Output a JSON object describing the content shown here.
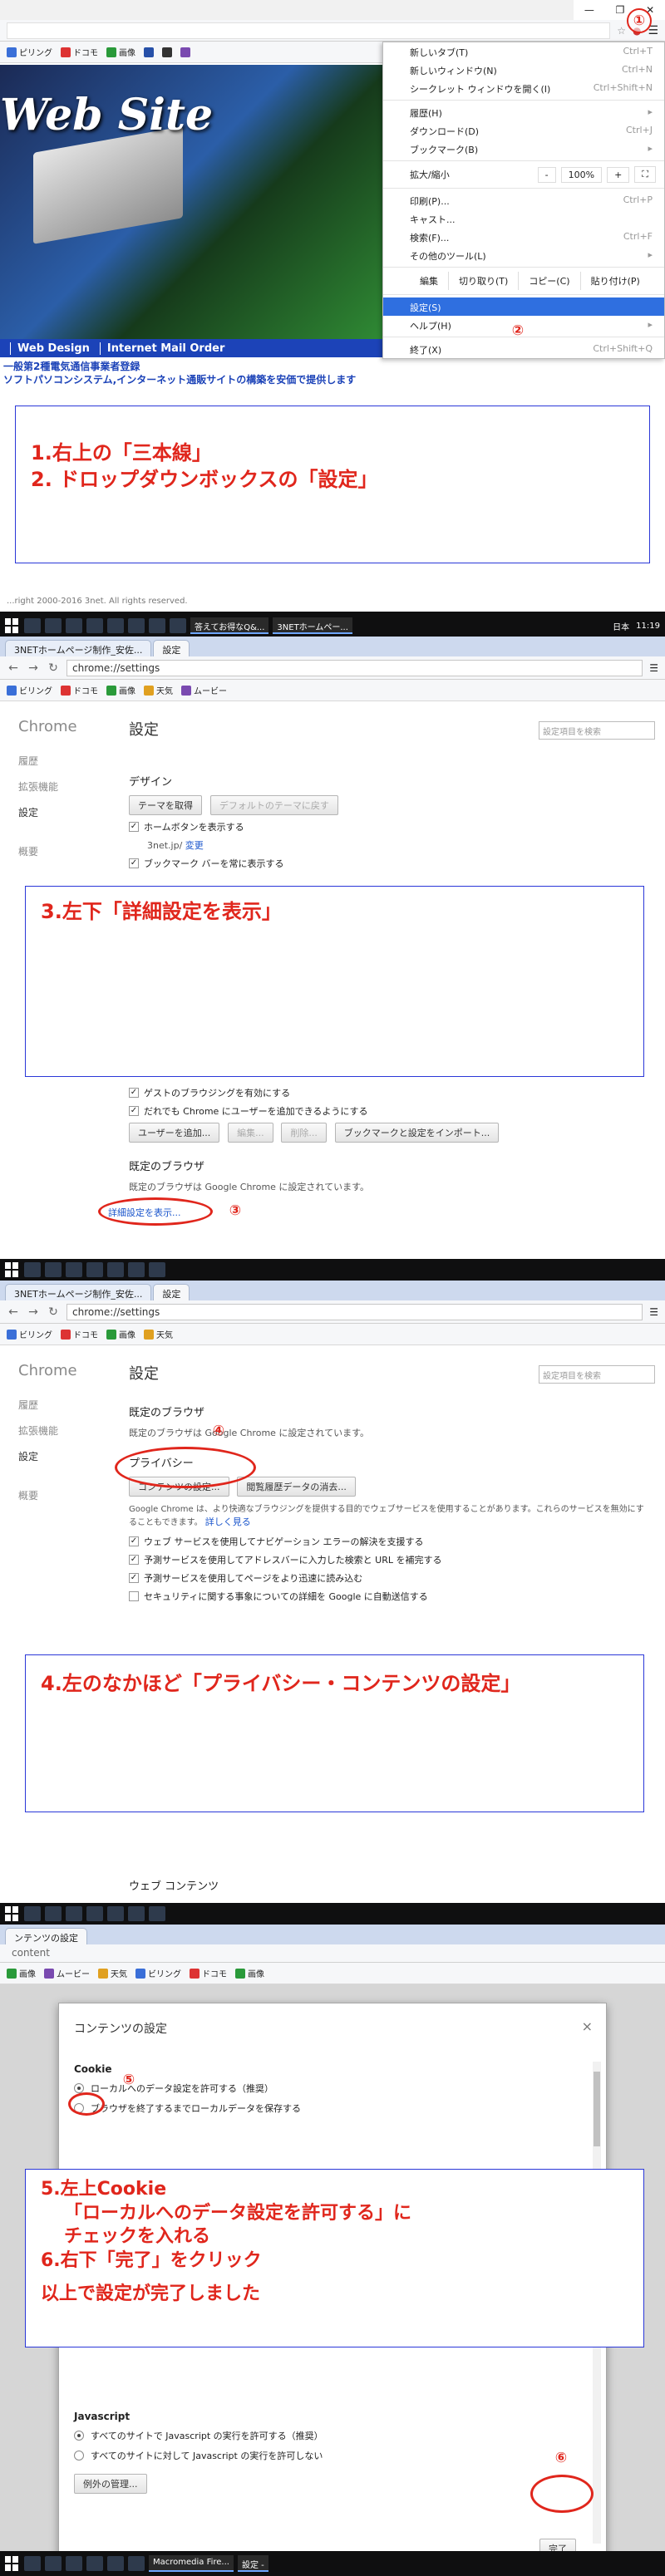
{
  "taskbar": {
    "apps": [
      "答えてお得なQ&...",
      "3NETホームペー..."
    ],
    "lang": "日本",
    "time": "11:19"
  },
  "step1": {
    "bookmarks": [
      "ピリング",
      "ドコモ",
      "画像"
    ],
    "site": {
      "title": "Web Site",
      "nav": [
        "Web Design",
        "Internet Mail Order"
      ],
      "line1": "一般第2種電気通信事業者登録",
      "line2": "ソフトパソコンシステム,インターネット通販サイトの構築を安価で提供します",
      "copyright": "...right 2000-2016 3net. All rights reserved."
    },
    "menu": {
      "items1": [
        {
          "label": "新しいタブ(T)",
          "shortcut": "Ctrl+T"
        },
        {
          "label": "新しいウィンドウ(N)",
          "shortcut": "Ctrl+N"
        },
        {
          "label": "シークレット ウィンドウを開く(I)",
          "shortcut": "Ctrl+Shift+N"
        }
      ],
      "items2": [
        {
          "label": "履歴(H)",
          "shortcut": "▸"
        },
        {
          "label": "ダウンロード(D)",
          "shortcut": "Ctrl+J"
        },
        {
          "label": "ブックマーク(B)",
          "shortcut": "▸"
        }
      ],
      "zoom": {
        "label": "拡大/縮小",
        "minus": "-",
        "value": "100%",
        "plus": "+",
        "full": "⛶"
      },
      "items3": [
        {
          "label": "印刷(P)...",
          "shortcut": "Ctrl+P"
        },
        {
          "label": "キャスト...",
          "shortcut": ""
        },
        {
          "label": "検索(F)...",
          "shortcut": "Ctrl+F"
        },
        {
          "label": "その他のツール(L)",
          "shortcut": "▸"
        }
      ],
      "edit": [
        "編集",
        "切り取り(T)",
        "コピー(C)",
        "貼り付け(P)"
      ],
      "settings": {
        "label": "設定(S)",
        "shortcut": ""
      },
      "help": {
        "label": "ヘルプ(H)",
        "shortcut": "▸"
      },
      "exit": {
        "label": "終了(X)",
        "shortcut": "Ctrl+Shift+Q"
      }
    },
    "annotation": [
      "1.右上の「三本線」",
      "2. ドロップダウンボックスの「設定」"
    ],
    "badges": [
      "①",
      "②"
    ]
  },
  "step2": {
    "tabs": [
      "3NETホームページ制作_安佐...",
      "設定"
    ],
    "url": "chrome://settings",
    "bookmarks": [
      "ビリング",
      "ドコモ",
      "画像",
      "天気",
      "ムービー"
    ],
    "sidebar": {
      "brand": "Chrome",
      "items": [
        "履歴",
        "拡張機能",
        "設定",
        "概要"
      ]
    },
    "title": "設定",
    "search_placeholder": "設定項目を検索",
    "design": {
      "head": "デザイン",
      "theme_button": "テーマを取得",
      "default_theme_button": "デフォルトのテーマに戻す",
      "home_button": "ホームボタンを表示する",
      "home_url": "3net.jp/",
      "home_change": "変更",
      "bookmark_bar": "ブックマーク バーを常に表示する"
    },
    "people": {
      "guest": "ゲストのブラウジングを有効にする",
      "anyone": "だれでも Chrome にユーザーを追加できるようにする",
      "buttons": [
        "ユーザーを追加...",
        "編集...",
        "削除...",
        "ブックマークと設定をインポート..."
      ]
    },
    "default_browser": {
      "head": "既定のブラウザ",
      "text": "既定のブラウザは Google Chrome に設定されています。"
    },
    "advanced_link": "詳細設定を表示...",
    "annotation": [
      "3.左下「詳細設定を表示」"
    ],
    "badge": "③"
  },
  "step3": {
    "default_browser": {
      "head": "既定のブラウザ",
      "text": "既定のブラウザは Google Chrome に設定されています。"
    },
    "privacy": {
      "head": "プライバシー",
      "content_button": "コンテンツの設定...",
      "clear_button": "閲覧履歴データの消去...",
      "desc": "Google Chrome は、より快適なブラウジングを提供する目的でウェブサービスを使用することがあります。これらのサービスを無効にすることもできます。",
      "desc_link": "詳しく見る",
      "checks": [
        "ウェブ サービスを使用してナビゲーション エラーの解決を支援する",
        "予測サービスを使用してアドレスバーに入力した検索と URL を補完する",
        "予測サービスを使用してページをより迅速に読み込む",
        "セキュリティに関する事象についての詳細を Google に自動送信する"
      ]
    },
    "web_content": "ウェブ コンテンツ",
    "annotation": [
      "4.左のなかほど「プライバシー・コンテンツの設定」"
    ],
    "badge": "④"
  },
  "step4": {
    "tab": "ンテンツの設定",
    "url": "content",
    "dialog": {
      "title": "コンテンツの設定",
      "close": "×",
      "cookie_head": "Cookie",
      "cookie_options": [
        "ローカルへのデータ設定を許可する（推奨）",
        "ブラウザを終了するまでローカルデータを保存する"
      ],
      "js_head": "Javascript",
      "js_options": [
        "すべてのサイトで Javascript の実行を許可する（推奨）",
        "すべてのサイトに対して Javascript の実行を許可しない"
      ],
      "exceptions_button": "例外の管理...",
      "done_button": "完了"
    },
    "annotation": [
      "5.左上Cookie",
      "「ローカルへのデータ設定を許可する」に",
      "チェックを入れる",
      "6.右下「完了」をクリック",
      "",
      "以上で設定が完了しました"
    ],
    "badges": [
      "⑤",
      "⑥"
    ],
    "taskbar_apps": [
      "Macromedia Fire...",
      "設定 -"
    ]
  },
  "colors": {
    "annotation_text": "#e0261c",
    "annotation_border": "#2a37d8",
    "highlight": "#2f6fe0"
  }
}
